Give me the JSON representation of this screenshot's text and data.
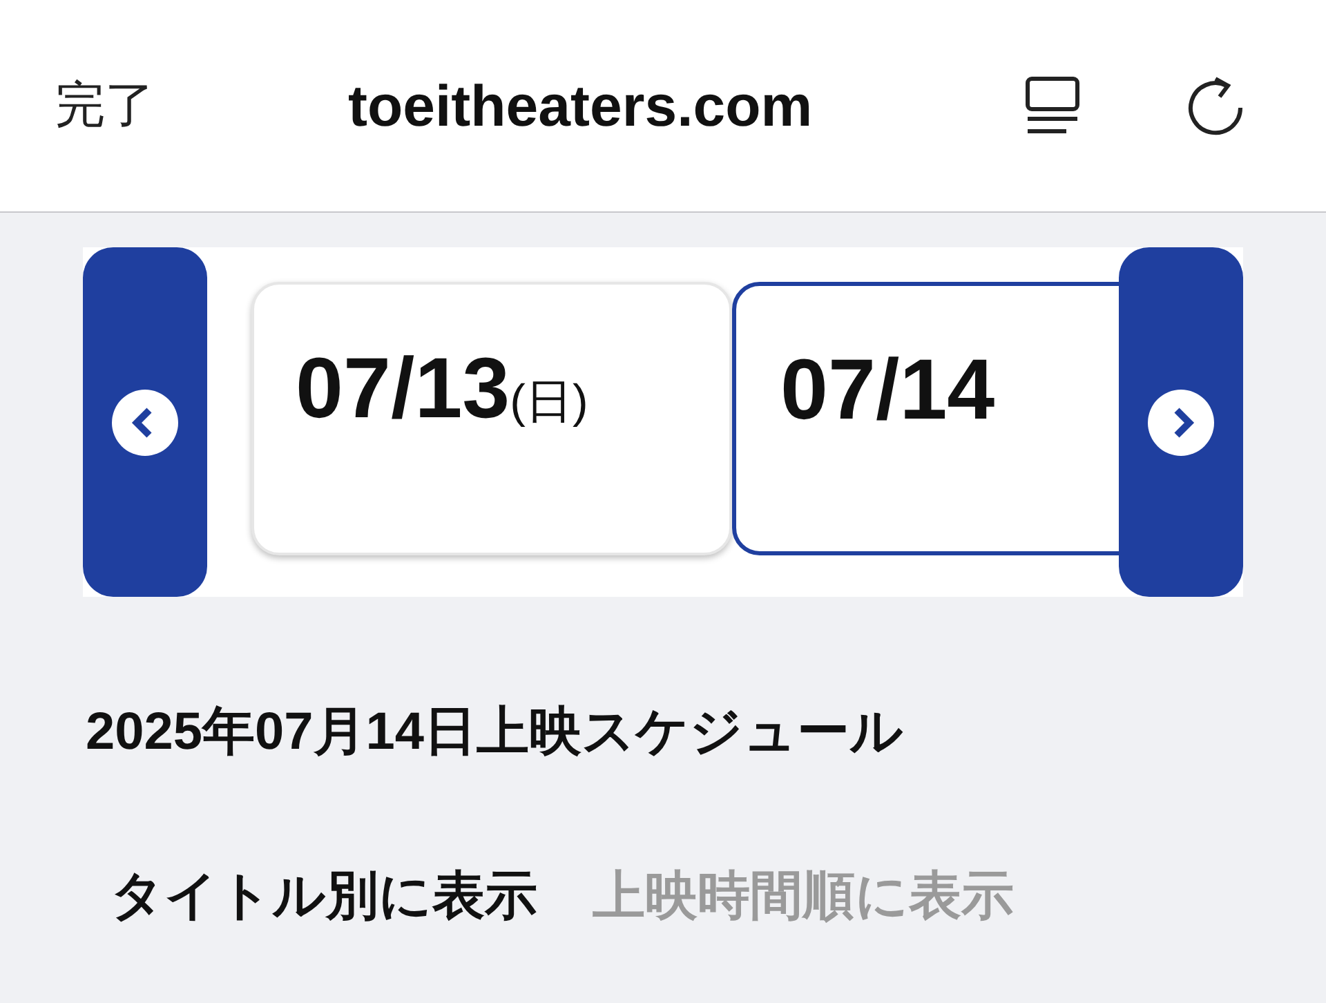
{
  "top_bar": {
    "done": "完了",
    "title": "toeitheaters.com"
  },
  "dates": [
    {
      "date": "07/13",
      "weekday": "(日)",
      "selected": false
    },
    {
      "date": "07/14",
      "selected": true
    }
  ],
  "heading": "2025年07月14日上映スケジュール",
  "view_tabs": [
    {
      "label": "タイトル別に表示",
      "selected": true
    },
    {
      "label": "上映時間順に表示",
      "selected": false
    }
  ]
}
